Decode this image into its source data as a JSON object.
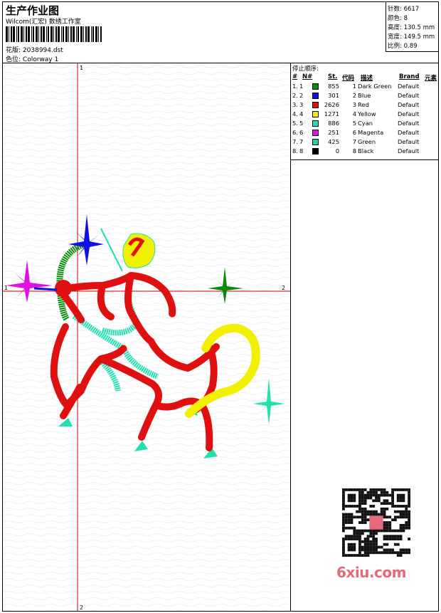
{
  "header": {
    "title": "生产作业图",
    "subtitle": "Wilcom(汇宏) 数绣工作室",
    "design_label": "花版:",
    "design_value": "2038994.dst",
    "colorway_label": "色位:",
    "colorway_value": "Colorway 1"
  },
  "stats": [
    {
      "label": "针数:",
      "value": "6617"
    },
    {
      "label": "颜色:",
      "value": "8"
    },
    {
      "label": "高度:",
      "value": "130.5 mm"
    },
    {
      "label": "宽度:",
      "value": "149.5 mm"
    },
    {
      "label": "比例:",
      "value": "0.89"
    }
  ],
  "canvas": {
    "axis_x_start": "1",
    "axis_x_end": "2",
    "axis_y_start": "1",
    "axis_y_end": "2"
  },
  "color_table": {
    "title": "停止顺序:",
    "headers": {
      "num": "#",
      "n": "N#",
      "st": "St.",
      "code": "代码",
      "desc": "描述",
      "brand": "Brand",
      "elem": "元素"
    },
    "rows": [
      {
        "num": "1.",
        "n": "1",
        "color": "#0a8a0a",
        "st": "855",
        "code": "1",
        "desc": "Dark Green",
        "brand": "Default"
      },
      {
        "num": "2.",
        "n": "2",
        "color": "#1010e0",
        "st": "301",
        "code": "2",
        "desc": "Blue",
        "brand": "Default"
      },
      {
        "num": "3.",
        "n": "3",
        "color": "#e01010",
        "st": "2626",
        "code": "3",
        "desc": "Red",
        "brand": "Default"
      },
      {
        "num": "4.",
        "n": "4",
        "color": "#f0f000",
        "st": "1271",
        "code": "4",
        "desc": "Yellow",
        "brand": "Default"
      },
      {
        "num": "5.",
        "n": "5",
        "color": "#20e0b0",
        "st": "886",
        "code": "5",
        "desc": "Cyan",
        "brand": "Default"
      },
      {
        "num": "6.",
        "n": "6",
        "color": "#e010e0",
        "st": "251",
        "code": "6",
        "desc": "Magenta",
        "brand": "Default"
      },
      {
        "num": "7.",
        "n": "7",
        "color": "#20d0a0",
        "st": "425",
        "code": "7",
        "desc": "Green",
        "brand": "Default"
      },
      {
        "num": "8.",
        "n": "8",
        "color": "#000000",
        "st": "0",
        "code": "8",
        "desc": "Black",
        "brand": "Default"
      }
    ]
  },
  "watermark": {
    "text": "6xiu.com",
    "icon": "qr-code-icon"
  }
}
